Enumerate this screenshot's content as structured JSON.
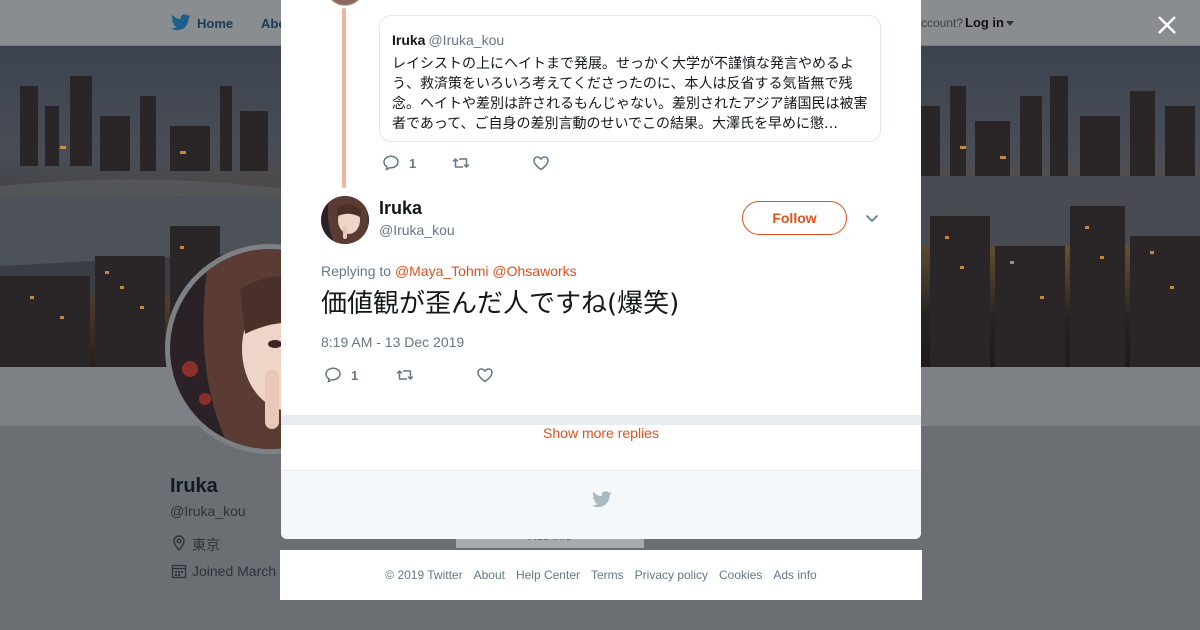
{
  "nav": {
    "home": "Home",
    "about": "Abo",
    "account_prompt": "ccount?",
    "login": "Log in"
  },
  "profile": {
    "name": "Iruka",
    "handle": "@Iruka_kou",
    "location": "東京",
    "joined": "Joined March"
  },
  "ads_ghost": "Ads info",
  "quoted_tweet": {
    "name": "Iruka",
    "handle": "@Iruka_kou",
    "text": "レイシストの上にヘイトまで発展。せっかく大学が不謹慎な発言やめるよう、救済策をいろいろ考えてくださったのに、本人は反省する気皆無で残念。ヘイトや差別は許されるもんじゃない。差別されたアジア諸国民は被害者であって、ご自身の差別言動のせいでこの結果。大澤氏を早めに懲…",
    "replies": "1"
  },
  "tweet": {
    "name": "Iruka",
    "handle": "@Iruka_kou",
    "follow_label": "Follow",
    "replying_prefix": "Replying to",
    "mention_1": "@Maya_Tohmi",
    "mention_2": "@Ohsaworks",
    "text": "価値観が歪んだ人ですね(爆笑)",
    "timestamp": "8:19 AM - 13 Dec 2019",
    "replies": "1"
  },
  "show_more": "Show more replies",
  "footer": {
    "copyright": "© 2019 Twitter",
    "about": "About",
    "help": "Help Center",
    "terms": "Terms",
    "privacy": "Privacy policy",
    "cookies": "Cookies",
    "ads": "Ads info"
  },
  "icons": {
    "brand": "twitter-bird-icon",
    "reply": "reply-icon",
    "retweet": "retweet-icon",
    "like": "heart-icon",
    "close": "close-icon",
    "caret": "chevron-down-icon",
    "location": "location-pin-icon",
    "calendar": "calendar-icon"
  },
  "colors": {
    "accent": "#e2511c",
    "thread_line": "#f0b49c",
    "muted_text": "#657786",
    "overlay": "#6b6f73"
  }
}
